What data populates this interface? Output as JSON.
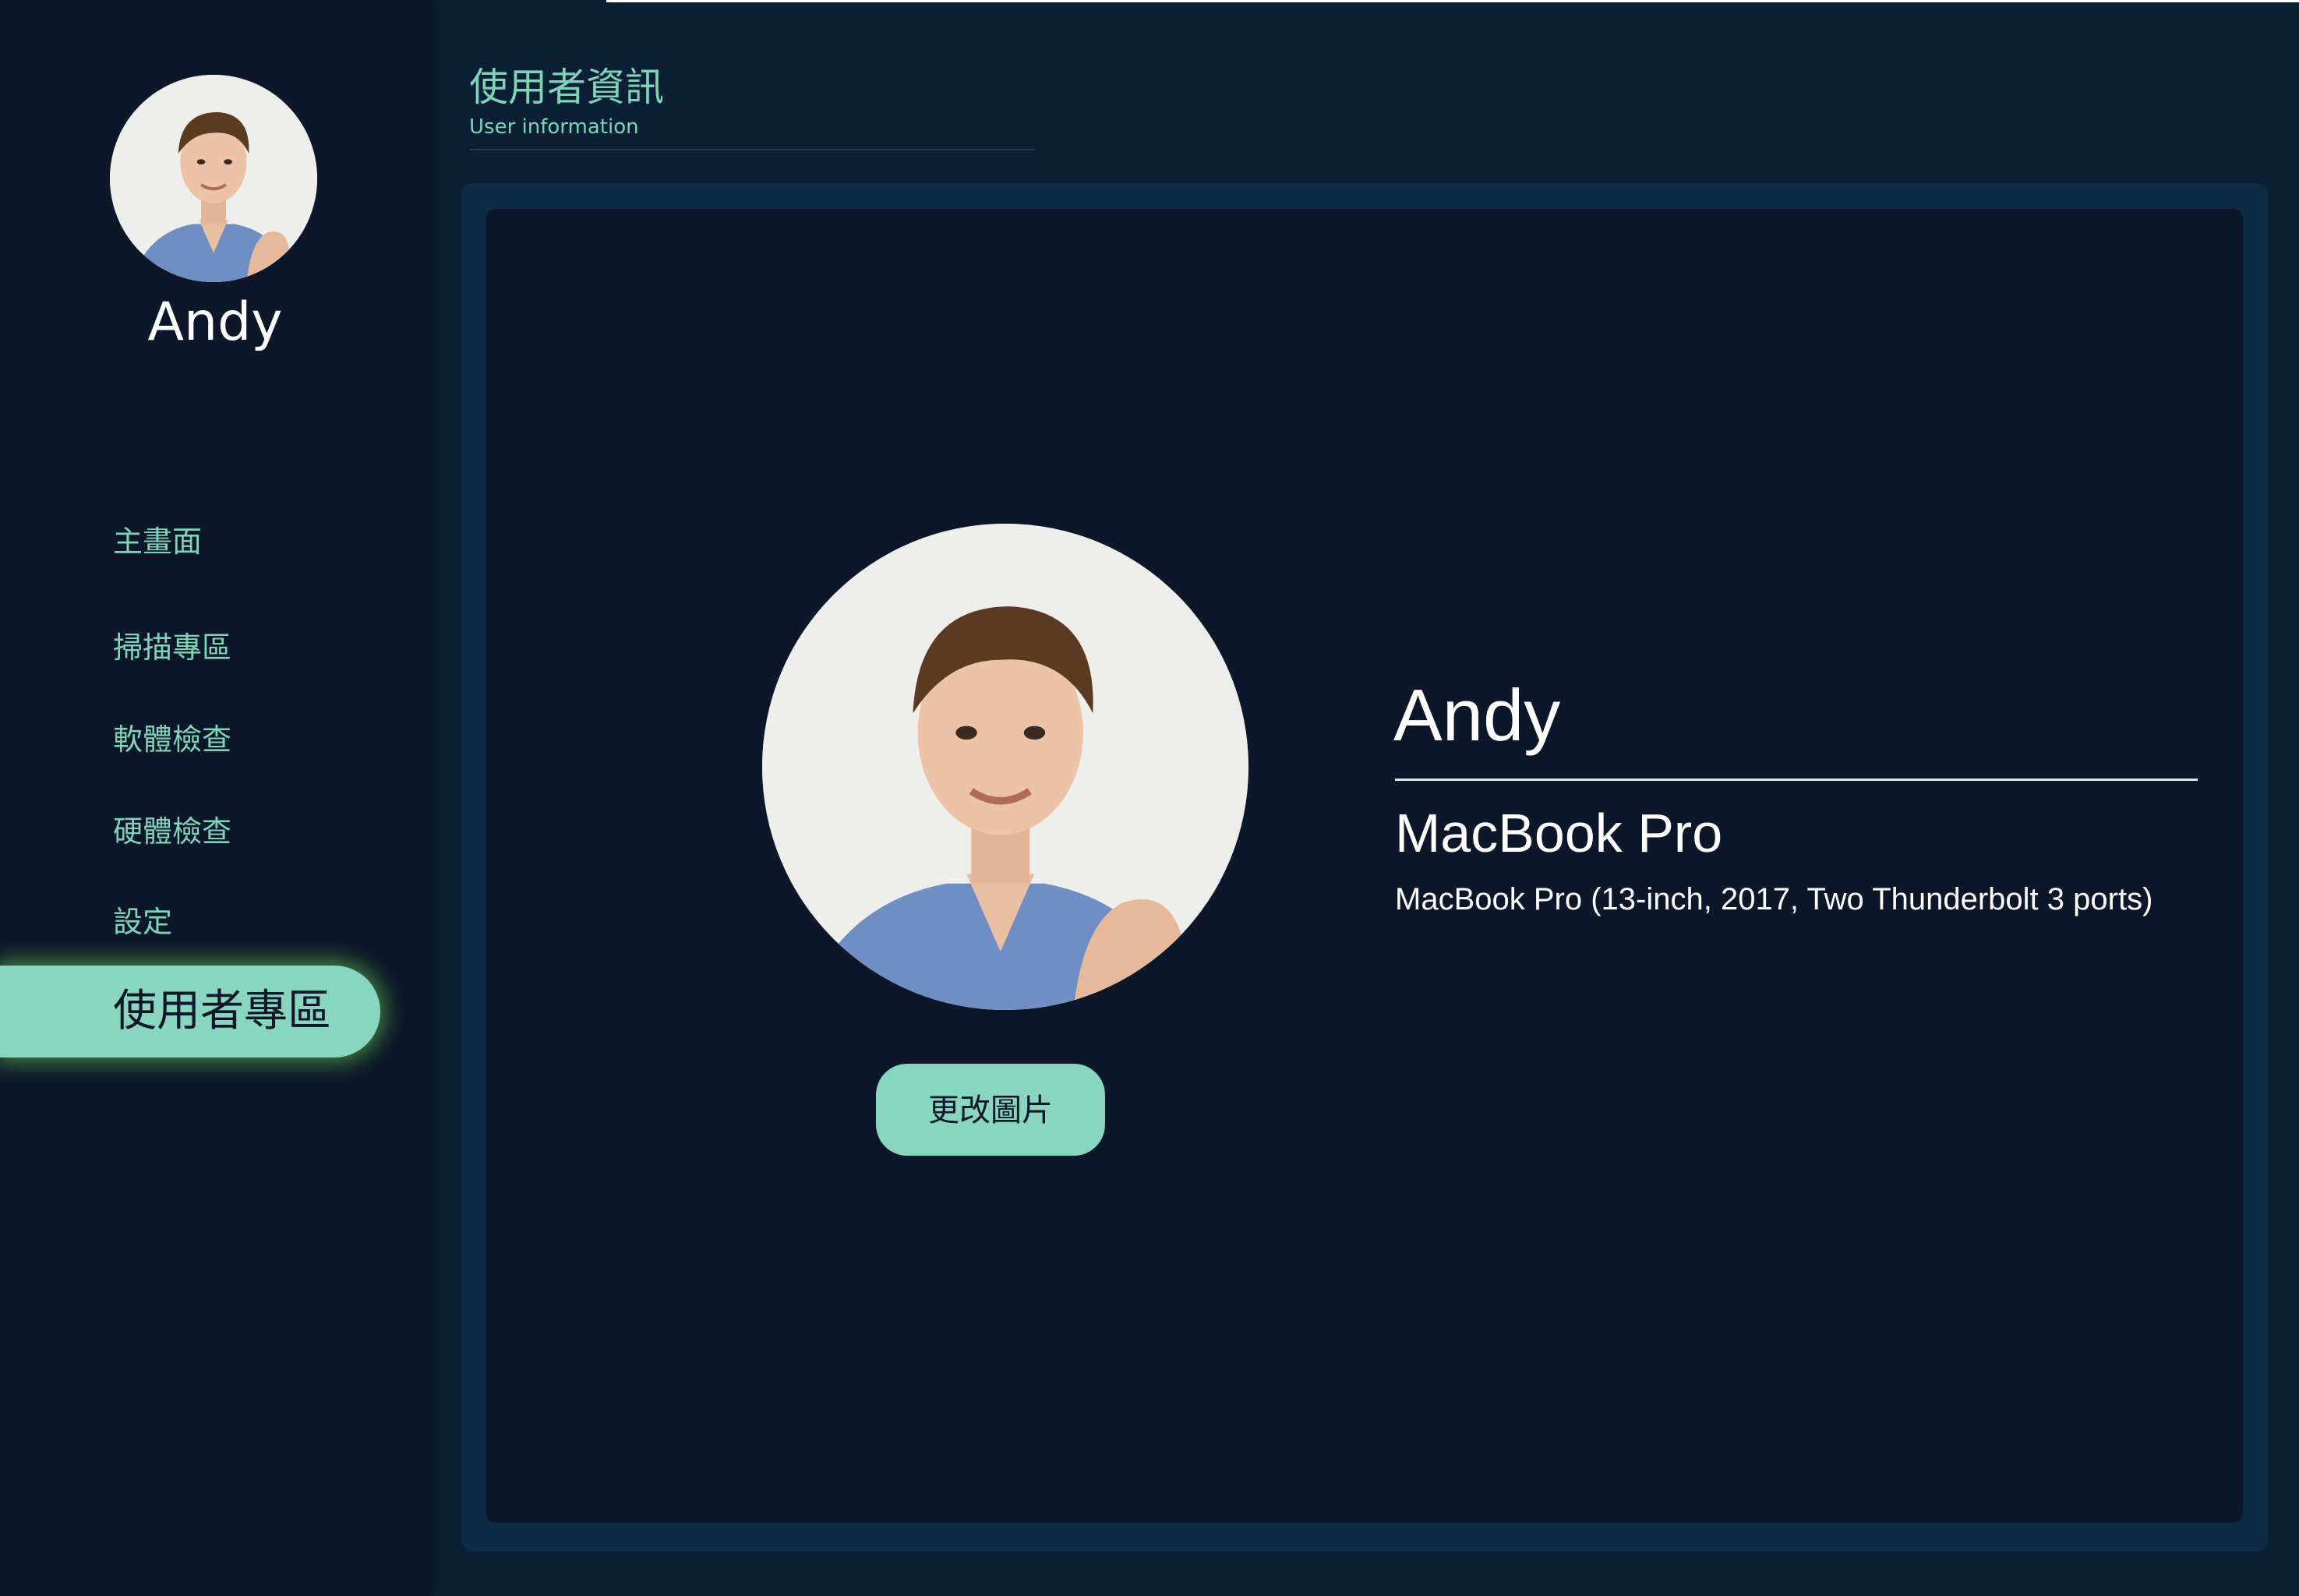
{
  "sidebar": {
    "user_name": "Andy",
    "avatar_icon": "user-avatar-photo",
    "nav_items": [
      {
        "label": "主畫面",
        "active": false
      },
      {
        "label": "掃描專區",
        "active": false
      },
      {
        "label": "軟體檢查",
        "active": false
      },
      {
        "label": "硬體檢查",
        "active": false
      },
      {
        "label": "設定",
        "active": false
      },
      {
        "label": "使用者專區",
        "active": true
      }
    ]
  },
  "header": {
    "title": "使用者資訊",
    "subtitle": "User information"
  },
  "profile": {
    "name": "Andy",
    "device_name": "MacBook Pro",
    "device_detail": "MacBook Pro (13-inch, 2017, Two Thunderbolt 3 ports)",
    "change_photo_label": "更改圖片",
    "photo_icon": "user-avatar-photo"
  },
  "colors": {
    "accent": "#88d6bf",
    "accent_text": "#7ed3b9",
    "sidebar_bg": "#0c1729",
    "page_bg": "#0b2035",
    "card_border": "#0e2b45",
    "glow": "#78e65a"
  }
}
